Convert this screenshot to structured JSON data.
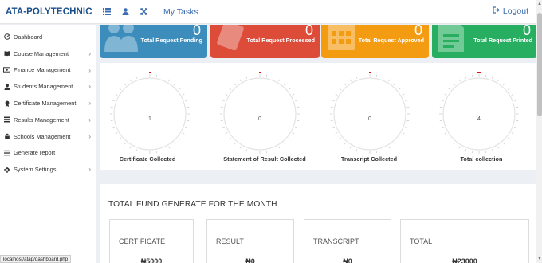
{
  "header": {
    "brand": "ATA-POLYTECHNIC",
    "my_tasks": "My Tasks",
    "logout": "Logout",
    "icons": [
      "menu-icon",
      "user-icon",
      "expand-icon"
    ]
  },
  "sidebar": {
    "items": [
      {
        "label": "Dashboard",
        "icon": "dashboard-icon",
        "chevron": false
      },
      {
        "label": "Course Management",
        "icon": "book-icon",
        "chevron": true
      },
      {
        "label": "Finance Management",
        "icon": "money-icon",
        "chevron": true
      },
      {
        "label": "Students Management",
        "icon": "user-icon",
        "chevron": true
      },
      {
        "label": "Certificate Management",
        "icon": "certificate-icon",
        "chevron": true
      },
      {
        "label": "Results Management",
        "icon": "list-icon",
        "chevron": true
      },
      {
        "label": "Schools Management",
        "icon": "school-icon",
        "chevron": true
      },
      {
        "label": "Generate report",
        "icon": "report-icon",
        "chevron": false
      },
      {
        "label": "System Settings",
        "icon": "gear-icon",
        "chevron": true
      }
    ]
  },
  "cards": [
    {
      "label": "Total Request Pending",
      "value": "0",
      "color": "#3c8dbc"
    },
    {
      "label": "Total Request Processed",
      "value": "0",
      "color": "#dd4b39"
    },
    {
      "label": "Total Request Approved",
      "value": "0",
      "color": "#f39c12"
    },
    {
      "label": "Total Request Printed",
      "value": "0",
      "color": "#27ae60"
    }
  ],
  "gauges": [
    {
      "label": "Certificate Collected",
      "value": "1",
      "level": 0.0
    },
    {
      "label": "Statement of Result Collected",
      "value": "0",
      "level": 0.0
    },
    {
      "label": "Transcript Collected",
      "value": "0",
      "level": 0.0
    },
    {
      "label": "Total collection",
      "value": "4",
      "level": 0.0
    }
  ],
  "fund": {
    "title": "TOTAL FUND GENERATE FOR THE MONTH",
    "boxes": [
      {
        "label": "CERTIFICATE",
        "value": "₦5000"
      },
      {
        "label": "RESULT",
        "value": "₦0"
      },
      {
        "label": "TRANSCRIPT",
        "value": "₦0"
      },
      {
        "label": "TOTAL",
        "value": "₦23000"
      }
    ]
  },
  "status_url": "localhost/atap/dashboard.php",
  "colors": {
    "accent": "#3c6db0",
    "gauge_marker": "#e01010"
  }
}
